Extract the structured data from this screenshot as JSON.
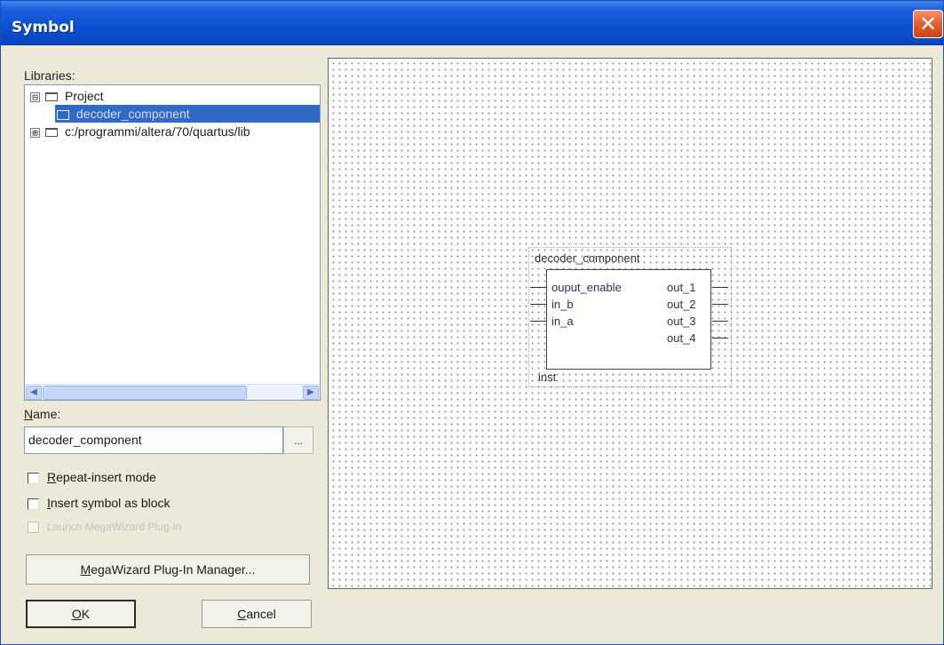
{
  "window": {
    "title": "Symbol"
  },
  "libraries": {
    "label": "Libraries:",
    "items": [
      {
        "label": "Project",
        "expander": "⊟",
        "icon": "open-folder-icon"
      },
      {
        "label": "decoder_component",
        "icon": "symbol-file-icon",
        "selected": true
      },
      {
        "label": "c:/programmi/altera/70/quartus/lib",
        "expander": "⊞",
        "icon": "folder-icon"
      }
    ]
  },
  "name": {
    "label_prefix": "N",
    "label_rest": "ame:",
    "value": "decoder_component",
    "browse_label": "..."
  },
  "options": {
    "repeat_insert": {
      "hot": "R",
      "rest": "epeat-insert mode",
      "checked": false
    },
    "insert_as_block": {
      "hot": "I",
      "rest": "nsert symbol as block",
      "checked": false
    },
    "launch_megawizard": {
      "text": "Launch MegaWizard Plug-In",
      "checked": false,
      "disabled": true
    }
  },
  "buttons": {
    "megawizard": {
      "hot": "M",
      "rest": "egaWizard Plug-In Manager..."
    },
    "ok": {
      "hot": "O",
      "rest": "K"
    },
    "cancel": {
      "hot": "C",
      "rest": "ancel"
    }
  },
  "symbol_preview": {
    "name": "decoder_component",
    "instance": "inst",
    "inputs": [
      "ouput_enable",
      "in_b",
      "in_a"
    ],
    "outputs": [
      "out_1",
      "out_2",
      "out_3",
      "out_4"
    ]
  }
}
